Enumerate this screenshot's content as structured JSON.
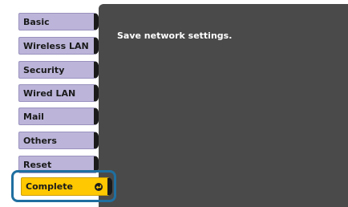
{
  "menu": {
    "items": [
      {
        "label": "Basic",
        "selected": false
      },
      {
        "label": "Wireless LAN",
        "selected": false
      },
      {
        "label": "Security",
        "selected": false
      },
      {
        "label": "Wired LAN",
        "selected": false
      },
      {
        "label": "Mail",
        "selected": false
      },
      {
        "label": "Others",
        "selected": false
      },
      {
        "label": "Reset",
        "selected": false
      },
      {
        "label": "Complete",
        "selected": true,
        "icon": "enter-icon"
      }
    ]
  },
  "panel": {
    "message": "Save network settings."
  },
  "colors": {
    "tab": "#bcb5d9",
    "selected_tab": "#ffc800",
    "panel_bg": "#4a4a4a",
    "highlight_border": "#1f6fa0"
  }
}
